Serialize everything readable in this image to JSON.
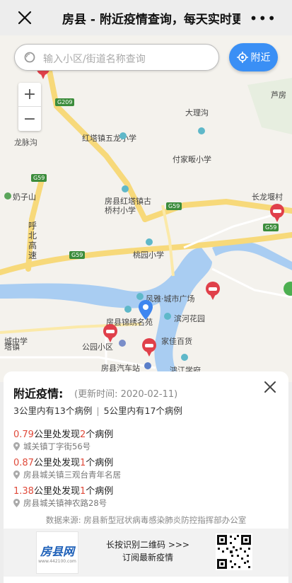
{
  "topbar": {
    "title": "房县 - 附近疫情查询，每天实时更新",
    "more_label": "•••"
  },
  "search": {
    "placeholder": "输入小区/街道名称查询"
  },
  "nearby_button": {
    "label": "附近"
  },
  "zoom": {
    "plus": "+",
    "minus": "−"
  },
  "map": {
    "road_labels": [
      "G209",
      "G59",
      "G59",
      "G59",
      "G59"
    ],
    "places": [
      {
        "name": "芦房"
      },
      {
        "name": "大理沟"
      },
      {
        "name": "红塔镇五龙小学"
      },
      {
        "name": "付家畈小学"
      },
      {
        "name": "龙脉沟"
      },
      {
        "name": "奶子山"
      },
      {
        "name": "房县红塔镇古桥村小学"
      },
      {
        "name": "长龙堰村"
      },
      {
        "name": "呼北高速"
      },
      {
        "name": "桃园小学"
      },
      {
        "name": "风雅·城市广场"
      },
      {
        "name": "房县锦绣名苑"
      },
      {
        "name": "滨河花园"
      },
      {
        "name": "城中学"
      },
      {
        "name": "家佳百货"
      },
      {
        "name": "塔镇"
      },
      {
        "name": "公园小区"
      },
      {
        "name": "房县汽车站"
      },
      {
        "name": "鸿江学府"
      }
    ]
  },
  "panel": {
    "heading": "附近疫情:",
    "updated": "(更新时间:  2020-02-11)",
    "summary_3km": "3公里内有13个病例",
    "summary_sep": "|",
    "summary_5km": "5公里内有17个病例",
    "cases": [
      {
        "distance": "0.79",
        "text_a": "公里处发现",
        "count": "2",
        "text_b": "个病例",
        "address": "城关镇丁字街56号"
      },
      {
        "distance": "0.87",
        "text_a": "公里处发现",
        "count": "1",
        "text_b": "个病例",
        "address": "房县城关镇三观台青年名居"
      },
      {
        "distance": "1.38",
        "text_a": "公里处发现",
        "count": "1",
        "text_b": "个病例",
        "address": "房县城关镇神农路28号"
      }
    ],
    "source": "数据来源:  房县新型冠状病毒感染肺炎防控指挥部办公室"
  },
  "footer": {
    "logo_text": "房县网",
    "logo_url": "www.442100.com",
    "line1": "长按识别二维码 >>>",
    "line2": "订阅最新疫情"
  },
  "colors": {
    "accent": "#3a8ff5",
    "alert": "#e04a3a",
    "marker": "#e0404a"
  }
}
